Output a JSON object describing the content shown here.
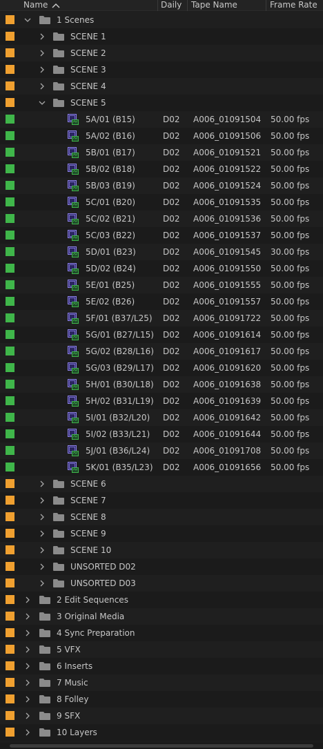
{
  "columns": {
    "name": "Name",
    "daily": "Daily",
    "tape": "Tape Name",
    "fps": "Frame Rate"
  },
  "colors": {
    "orange": "#f0a030",
    "green": "#3fb64a"
  },
  "rows": [
    {
      "type": "folder",
      "depth": 0,
      "expanded": true,
      "label": "1 Scenes",
      "color": "orange"
    },
    {
      "type": "folder",
      "depth": 1,
      "expanded": false,
      "label": "SCENE 1",
      "color": "orange"
    },
    {
      "type": "folder",
      "depth": 1,
      "expanded": false,
      "label": "SCENE 2",
      "color": "orange"
    },
    {
      "type": "folder",
      "depth": 1,
      "expanded": false,
      "label": "SCENE 3",
      "color": "orange"
    },
    {
      "type": "folder",
      "depth": 1,
      "expanded": false,
      "label": "SCENE 4",
      "color": "orange"
    },
    {
      "type": "folder",
      "depth": 1,
      "expanded": true,
      "label": "SCENE 5",
      "color": "orange"
    },
    {
      "type": "clip",
      "depth": 2,
      "label": "5A/01 (B15)",
      "daily": "D02",
      "tape": "A006_01091504",
      "fps": "50.00 fps",
      "color": "green"
    },
    {
      "type": "clip",
      "depth": 2,
      "label": "5A/02 (B16)",
      "daily": "D02",
      "tape": "A006_01091506",
      "fps": "50.00 fps",
      "color": "green"
    },
    {
      "type": "clip",
      "depth": 2,
      "label": "5B/01 (B17)",
      "daily": "D02",
      "tape": "A006_01091521",
      "fps": "50.00 fps",
      "color": "green"
    },
    {
      "type": "clip",
      "depth": 2,
      "label": "5B/02 (B18)",
      "daily": "D02",
      "tape": "A006_01091522",
      "fps": "50.00 fps",
      "color": "green"
    },
    {
      "type": "clip",
      "depth": 2,
      "label": "5B/03 (B19)",
      "daily": "D02",
      "tape": "A006_01091524",
      "fps": "50.00 fps",
      "color": "green"
    },
    {
      "type": "clip",
      "depth": 2,
      "label": "5C/01 (B20)",
      "daily": "D02",
      "tape": "A006_01091535",
      "fps": "50.00 fps",
      "color": "green"
    },
    {
      "type": "clip",
      "depth": 2,
      "label": "5C/02 (B21)",
      "daily": "D02",
      "tape": "A006_01091536",
      "fps": "50.00 fps",
      "color": "green"
    },
    {
      "type": "clip",
      "depth": 2,
      "label": "5C/03 (B22)",
      "daily": "D02",
      "tape": "A006_01091537",
      "fps": "50.00 fps",
      "color": "green"
    },
    {
      "type": "clip",
      "depth": 2,
      "label": "5D/01 (B23)",
      "daily": "D02",
      "tape": "A006_01091545",
      "fps": "30.00 fps",
      "color": "green"
    },
    {
      "type": "clip",
      "depth": 2,
      "label": "5D/02 (B24)",
      "daily": "D02",
      "tape": "A006_01091550",
      "fps": "50.00 fps",
      "color": "green"
    },
    {
      "type": "clip",
      "depth": 2,
      "label": "5E/01 (B25)",
      "daily": "D02",
      "tape": "A006_01091555",
      "fps": "50.00 fps",
      "color": "green"
    },
    {
      "type": "clip",
      "depth": 2,
      "label": "5E/02 (B26)",
      "daily": "D02",
      "tape": "A006_01091557",
      "fps": "50.00 fps",
      "color": "green"
    },
    {
      "type": "clip",
      "depth": 2,
      "label": "5F/01 (B37/L25)",
      "daily": "D02",
      "tape": "A006_01091722",
      "fps": "50.00 fps",
      "color": "green"
    },
    {
      "type": "clip",
      "depth": 2,
      "label": "5G/01 (B27/L15)",
      "daily": "D02",
      "tape": "A006_01091614",
      "fps": "50.00 fps",
      "color": "green"
    },
    {
      "type": "clip",
      "depth": 2,
      "label": "5G/02 (B28/L16)",
      "daily": "D02",
      "tape": "A006_01091617",
      "fps": "50.00 fps",
      "color": "green"
    },
    {
      "type": "clip",
      "depth": 2,
      "label": "5G/03 (B29/L17)",
      "daily": "D02",
      "tape": "A006_01091620",
      "fps": "50.00 fps",
      "color": "green"
    },
    {
      "type": "clip",
      "depth": 2,
      "label": "5H/01 (B30/L18)",
      "daily": "D02",
      "tape": "A006_01091638",
      "fps": "50.00 fps",
      "color": "green"
    },
    {
      "type": "clip",
      "depth": 2,
      "label": "5H/02 (B31/L19)",
      "daily": "D02",
      "tape": "A006_01091639",
      "fps": "50.00 fps",
      "color": "green"
    },
    {
      "type": "clip",
      "depth": 2,
      "label": "5I/01 (B32/L20)",
      "daily": "D02",
      "tape": "A006_01091642",
      "fps": "50.00 fps",
      "color": "green"
    },
    {
      "type": "clip",
      "depth": 2,
      "label": "5I/02 (B33/L21)",
      "daily": "D02",
      "tape": "A006_01091644",
      "fps": "50.00 fps",
      "color": "green"
    },
    {
      "type": "clip",
      "depth": 2,
      "label": "5J/01 (B36/L24)",
      "daily": "D02",
      "tape": "A006_01091708",
      "fps": "50.00 fps",
      "color": "green"
    },
    {
      "type": "clip",
      "depth": 2,
      "label": "5K/01 (B35/L23)",
      "daily": "D02",
      "tape": "A006_01091656",
      "fps": "50.00 fps",
      "color": "green"
    },
    {
      "type": "folder",
      "depth": 1,
      "expanded": false,
      "label": "SCENE 6",
      "color": "orange"
    },
    {
      "type": "folder",
      "depth": 1,
      "expanded": false,
      "label": "SCENE 7",
      "color": "orange"
    },
    {
      "type": "folder",
      "depth": 1,
      "expanded": false,
      "label": "SCENE 8",
      "color": "orange"
    },
    {
      "type": "folder",
      "depth": 1,
      "expanded": false,
      "label": "SCENE 9",
      "color": "orange"
    },
    {
      "type": "folder",
      "depth": 1,
      "expanded": false,
      "label": "SCENE 10",
      "color": "orange"
    },
    {
      "type": "folder",
      "depth": 1,
      "expanded": false,
      "label": "UNSORTED D02",
      "color": "orange"
    },
    {
      "type": "folder",
      "depth": 1,
      "expanded": false,
      "label": "UNSORTED D03",
      "color": "orange"
    },
    {
      "type": "folder",
      "depth": 0,
      "expanded": false,
      "label": "2 Edit Sequences",
      "color": "orange"
    },
    {
      "type": "folder",
      "depth": 0,
      "expanded": false,
      "label": "3 Original Media",
      "color": "orange"
    },
    {
      "type": "folder",
      "depth": 0,
      "expanded": false,
      "label": "4 Sync Preparation",
      "color": "orange"
    },
    {
      "type": "folder",
      "depth": 0,
      "expanded": false,
      "label": "5 VFX",
      "color": "orange"
    },
    {
      "type": "folder",
      "depth": 0,
      "expanded": false,
      "label": "6 Inserts",
      "color": "orange"
    },
    {
      "type": "folder",
      "depth": 0,
      "expanded": false,
      "label": "7 Music",
      "color": "orange"
    },
    {
      "type": "folder",
      "depth": 0,
      "expanded": false,
      "label": "8 Folley",
      "color": "orange"
    },
    {
      "type": "folder",
      "depth": 0,
      "expanded": false,
      "label": "9 SFX",
      "color": "orange"
    },
    {
      "type": "folder",
      "depth": 0,
      "expanded": false,
      "label": "10 Layers",
      "color": "orange"
    }
  ]
}
